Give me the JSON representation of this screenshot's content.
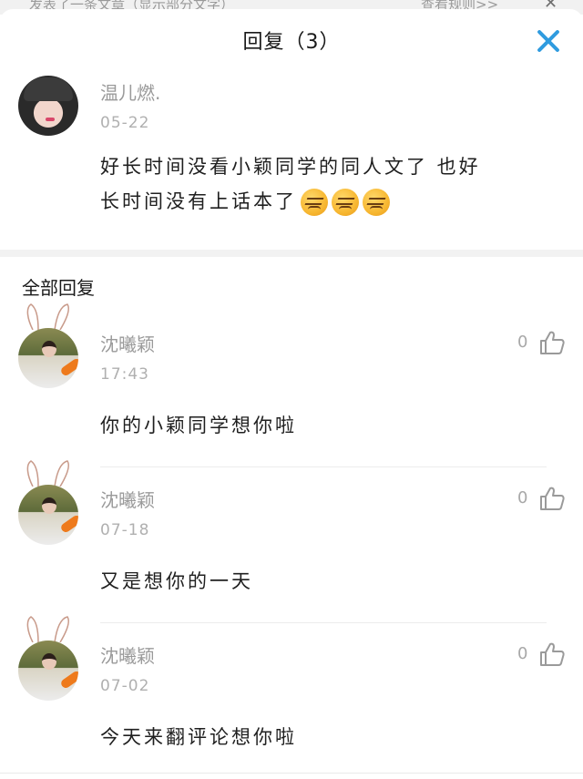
{
  "background": {
    "left_text": "发表了一条文章（显示部分文字）",
    "right_text": "查看规则>>"
  },
  "header": {
    "title": "回复（3）",
    "close_icon": "close-icon",
    "accent_color": "#2f9bdf"
  },
  "original": {
    "author": "温儿燃.",
    "date": "05-22",
    "text_line1": "好长时间没看小颖同学的同人文了 也好",
    "text_line2": "长时间没有上话本了",
    "emoji_count": 3,
    "emoji_icon": "grimacing-face-icon"
  },
  "replies_section": {
    "title": "全部回复",
    "replies": [
      {
        "author": "沈曦颖",
        "time": "17:43",
        "likes": "0",
        "text": "你的小颖同学想你啦"
      },
      {
        "author": "沈曦颖",
        "time": "07-18",
        "likes": "0",
        "text": "又是想你的一天"
      },
      {
        "author": "沈曦颖",
        "time": "07-02",
        "likes": "0",
        "text": "今天来翻评论想你啦"
      }
    ]
  }
}
